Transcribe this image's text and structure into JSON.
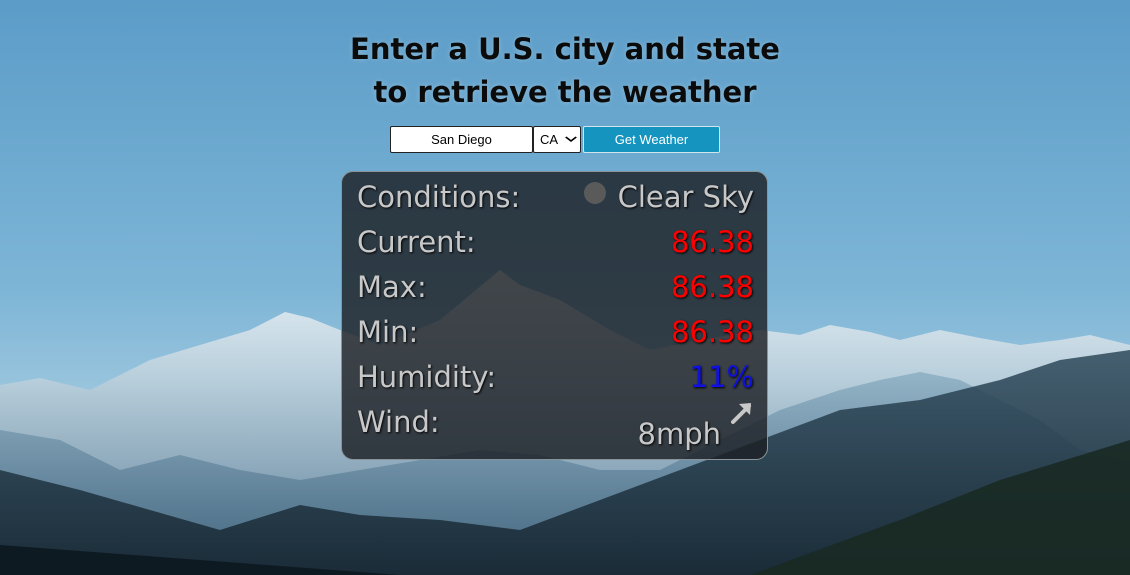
{
  "heading": {
    "line1": "Enter a U.S. city and state",
    "line2": "to retrieve the weather"
  },
  "form": {
    "city_value": "San Diego",
    "state_value": "CA",
    "button_label": "Get Weather"
  },
  "weather": {
    "conditions_label": "Conditions:",
    "conditions_value": "Clear Sky",
    "conditions_icon": "weather-condition-icon",
    "current_label": "Current:",
    "current_value": "86.38",
    "max_label": "Max:",
    "max_value": "86.38",
    "min_label": "Min:",
    "min_value": "86.38",
    "humidity_label": "Humidity:",
    "humidity_value": "11%",
    "wind_label": "Wind:",
    "wind_value": "8mph",
    "wind_icon": "wind-direction-arrow-icon"
  },
  "colors": {
    "button": "#1594bf",
    "temperature": "#ff0000",
    "humidity": "#1010e0",
    "panel_bg": "rgba(28,32,36,0.82)"
  }
}
